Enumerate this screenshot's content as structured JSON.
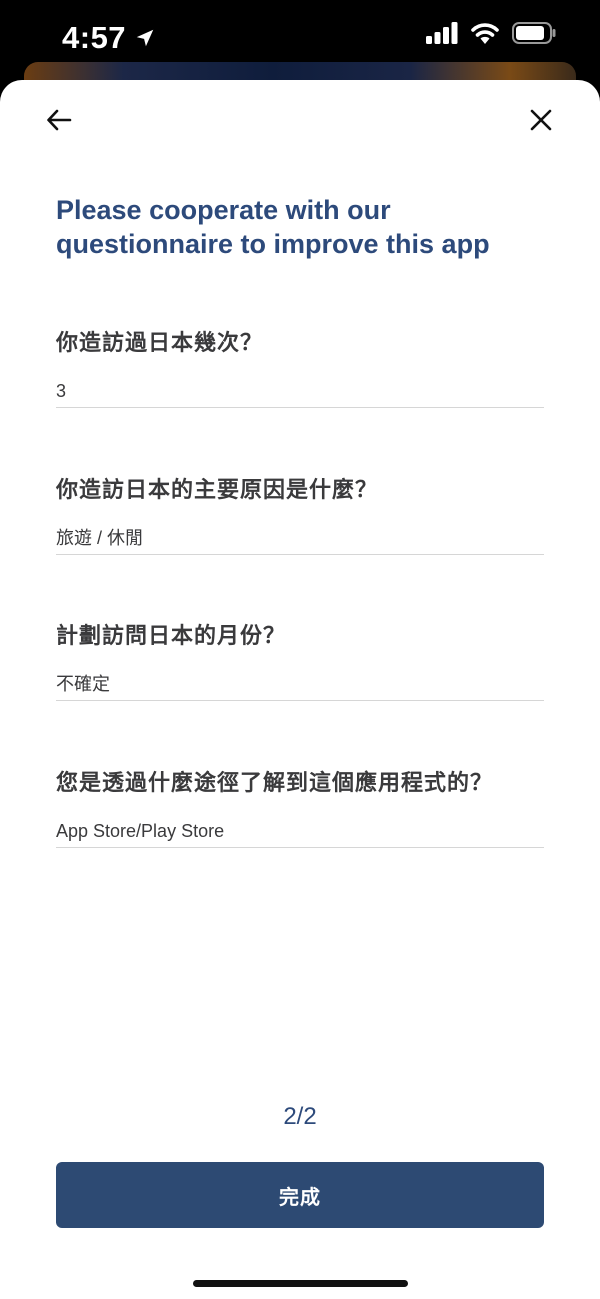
{
  "status_bar": {
    "time": "4:57",
    "icons": [
      "location-arrow-icon",
      "cellular-signal-icon",
      "wifi-icon",
      "battery-icon"
    ]
  },
  "nav": {
    "back_icon": "arrow-left-icon",
    "close_icon": "close-icon"
  },
  "title": "Please cooperate with our questionnaire to improve this app",
  "questions": [
    {
      "label": "你造訪過日本幾次？",
      "answer": "3"
    },
    {
      "label": "你造訪日本的主要原因是什麼？",
      "answer": "旅遊 / 休閒"
    },
    {
      "label": "計劃訪問日本的月份？",
      "answer": "不確定"
    },
    {
      "label": "您是透過什麼途徑了解到這個應用程式的？",
      "answer": "App Store/Play Store"
    }
  ],
  "page_indicator": "2/2",
  "done_button_label": "完成",
  "colors": {
    "accent": "#2d4a7b",
    "button": "#2d4a73",
    "text": "#3a3a3c",
    "divider": "#d6d6d6"
  }
}
